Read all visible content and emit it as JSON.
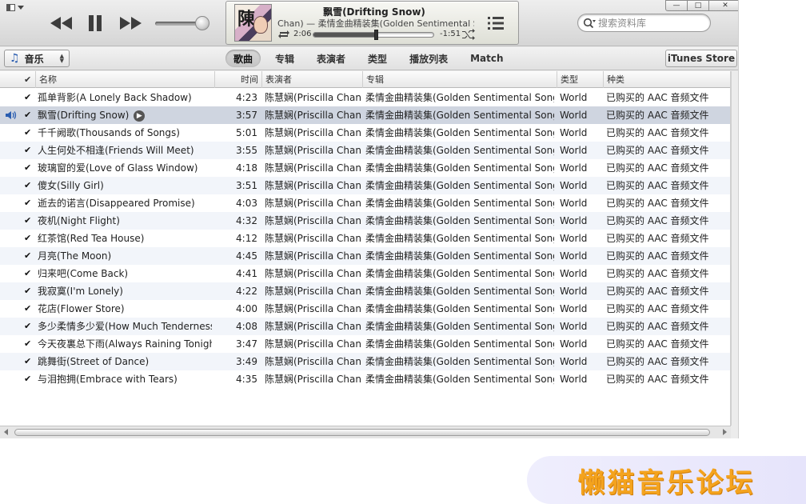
{
  "player": {
    "now_playing_title": "飘雪(Drifting Snow)",
    "now_playing_subtitle": "Chan) — 柔情金曲精装集(Golden Sentimental Song",
    "elapsed": "2:06",
    "remaining": "-1:51",
    "progress_fraction": 0.52,
    "volume_fraction": 0.9,
    "art_glyph": "陳"
  },
  "search": {
    "placeholder": "搜索资料库"
  },
  "window_buttons": {
    "minimize": "—",
    "maximize": "□",
    "close": "✕"
  },
  "library": {
    "label": "音乐"
  },
  "tabs": [
    {
      "label": "歌曲",
      "active": true
    },
    {
      "label": "专辑",
      "active": false
    },
    {
      "label": "表演者",
      "active": false
    },
    {
      "label": "类型",
      "active": false
    },
    {
      "label": "播放列表",
      "active": false
    },
    {
      "label": "Match",
      "active": false
    }
  ],
  "store_button": "iTunes Store",
  "columns": {
    "check": "✔",
    "name": "名称",
    "time": "时间",
    "artist": "表演者",
    "album": "专辑",
    "genre": "类型",
    "kind": "种类"
  },
  "tracks": [
    {
      "name": "孤单背影(A Lonely Back Shadow)",
      "time": "4:23",
      "artist": "陈慧娴(Priscilla Chan)",
      "album": "柔情金曲精装集(Golden Sentimental Song...",
      "genre": "World",
      "kind": "已购买的 AAC 音频文件",
      "checked": "✔"
    },
    {
      "name": "飘雪(Drifting Snow)",
      "time": "3:57",
      "artist": "陈慧娴(Priscilla Chan)",
      "album": "柔情金曲精装集(Golden Sentimental Song...",
      "genre": "World",
      "kind": "已购买的 AAC 音频文件",
      "checked": "✔",
      "playing": true
    },
    {
      "name": "千千阙歌(Thousands of Songs)",
      "time": "5:01",
      "artist": "陈慧娴(Priscilla Chan)",
      "album": "柔情金曲精装集(Golden Sentimental Song...",
      "genre": "World",
      "kind": "已购买的 AAC 音频文件",
      "checked": "✔"
    },
    {
      "name": "人生何处不相逢(Friends Will Meet)",
      "time": "3:55",
      "artist": "陈慧娴(Priscilla Chan)",
      "album": "柔情金曲精装集(Golden Sentimental Song...",
      "genre": "World",
      "kind": "已购买的 AAC 音频文件",
      "checked": "✔"
    },
    {
      "name": "玻璃窗的爱(Love of Glass Window)",
      "time": "4:18",
      "artist": "陈慧娴(Priscilla Chan)",
      "album": "柔情金曲精装集(Golden Sentimental Song...",
      "genre": "World",
      "kind": "已购买的 AAC 音频文件",
      "checked": "✔"
    },
    {
      "name": "傻女(Silly Girl)",
      "time": "3:51",
      "artist": "陈慧娴(Priscilla Chan)",
      "album": "柔情金曲精装集(Golden Sentimental Song...",
      "genre": "World",
      "kind": "已购买的 AAC 音频文件",
      "checked": "✔"
    },
    {
      "name": "逝去的诺言(Disappeared Promise)",
      "time": "4:03",
      "artist": "陈慧娴(Priscilla Chan)",
      "album": "柔情金曲精装集(Golden Sentimental Song...",
      "genre": "World",
      "kind": "已购买的 AAC 音频文件",
      "checked": "✔"
    },
    {
      "name": "夜机(Night Flight)",
      "time": "4:32",
      "artist": "陈慧娴(Priscilla Chan)",
      "album": "柔情金曲精装集(Golden Sentimental Song...",
      "genre": "World",
      "kind": "已购买的 AAC 音频文件",
      "checked": "✔"
    },
    {
      "name": "红茶馆(Red Tea House)",
      "time": "4:12",
      "artist": "陈慧娴(Priscilla Chan)",
      "album": "柔情金曲精装集(Golden Sentimental Song...",
      "genre": "World",
      "kind": "已购买的 AAC 音频文件",
      "checked": "✔"
    },
    {
      "name": "月亮(The Moon)",
      "time": "4:45",
      "artist": "陈慧娴(Priscilla Chan)",
      "album": "柔情金曲精装集(Golden Sentimental Song...",
      "genre": "World",
      "kind": "已购买的 AAC 音频文件",
      "checked": "✔"
    },
    {
      "name": "归来吧(Come Back)",
      "time": "4:41",
      "artist": "陈慧娴(Priscilla Chan)",
      "album": "柔情金曲精装集(Golden Sentimental Song...",
      "genre": "World",
      "kind": "已购买的 AAC 音频文件",
      "checked": "✔"
    },
    {
      "name": "我寂寞(I'm Lonely)",
      "time": "4:22",
      "artist": "陈慧娴(Priscilla Chan)",
      "album": "柔情金曲精装集(Golden Sentimental Song...",
      "genre": "World",
      "kind": "已购买的 AAC 音频文件",
      "checked": "✔"
    },
    {
      "name": "花店(Flower Store)",
      "time": "4:00",
      "artist": "陈慧娴(Priscilla Chan)",
      "album": "柔情金曲精装集(Golden Sentimental Song...",
      "genre": "World",
      "kind": "已购买的 AAC 音频文件",
      "checked": "✔"
    },
    {
      "name": "多少柔情多少爱(How Much Tenderness)",
      "time": "4:08",
      "artist": "陈慧娴(Priscilla Chan)",
      "album": "柔情金曲精装集(Golden Sentimental Song...",
      "genre": "World",
      "kind": "已购买的 AAC 音频文件",
      "checked": "✔"
    },
    {
      "name": "今天夜裏总下雨(Always Raining Tonight)",
      "time": "3:47",
      "artist": "陈慧娴(Priscilla Chan)",
      "album": "柔情金曲精装集(Golden Sentimental Song...",
      "genre": "World",
      "kind": "已购买的 AAC 音频文件",
      "checked": "✔"
    },
    {
      "name": "跳舞街(Street of Dance)",
      "time": "3:49",
      "artist": "陈慧娴(Priscilla Chan)",
      "album": "柔情金曲精装集(Golden Sentimental Song...",
      "genre": "World",
      "kind": "已购买的 AAC 音频文件",
      "checked": "✔"
    },
    {
      "name": "与泪抱拥(Embrace with Tears)",
      "time": "4:35",
      "artist": "陈慧娴(Priscilla Chan)",
      "album": "柔情金曲精装集(Golden Sentimental Song...",
      "genre": "World",
      "kind": "已购买的 AAC 音频文件",
      "checked": "✔"
    }
  ],
  "watermark": "懒猫音乐论坛",
  "colors": {
    "accent_blue": "#2a5db0",
    "playing_row": "#cfd5e0",
    "watermark_orange": "#f4a31e"
  }
}
